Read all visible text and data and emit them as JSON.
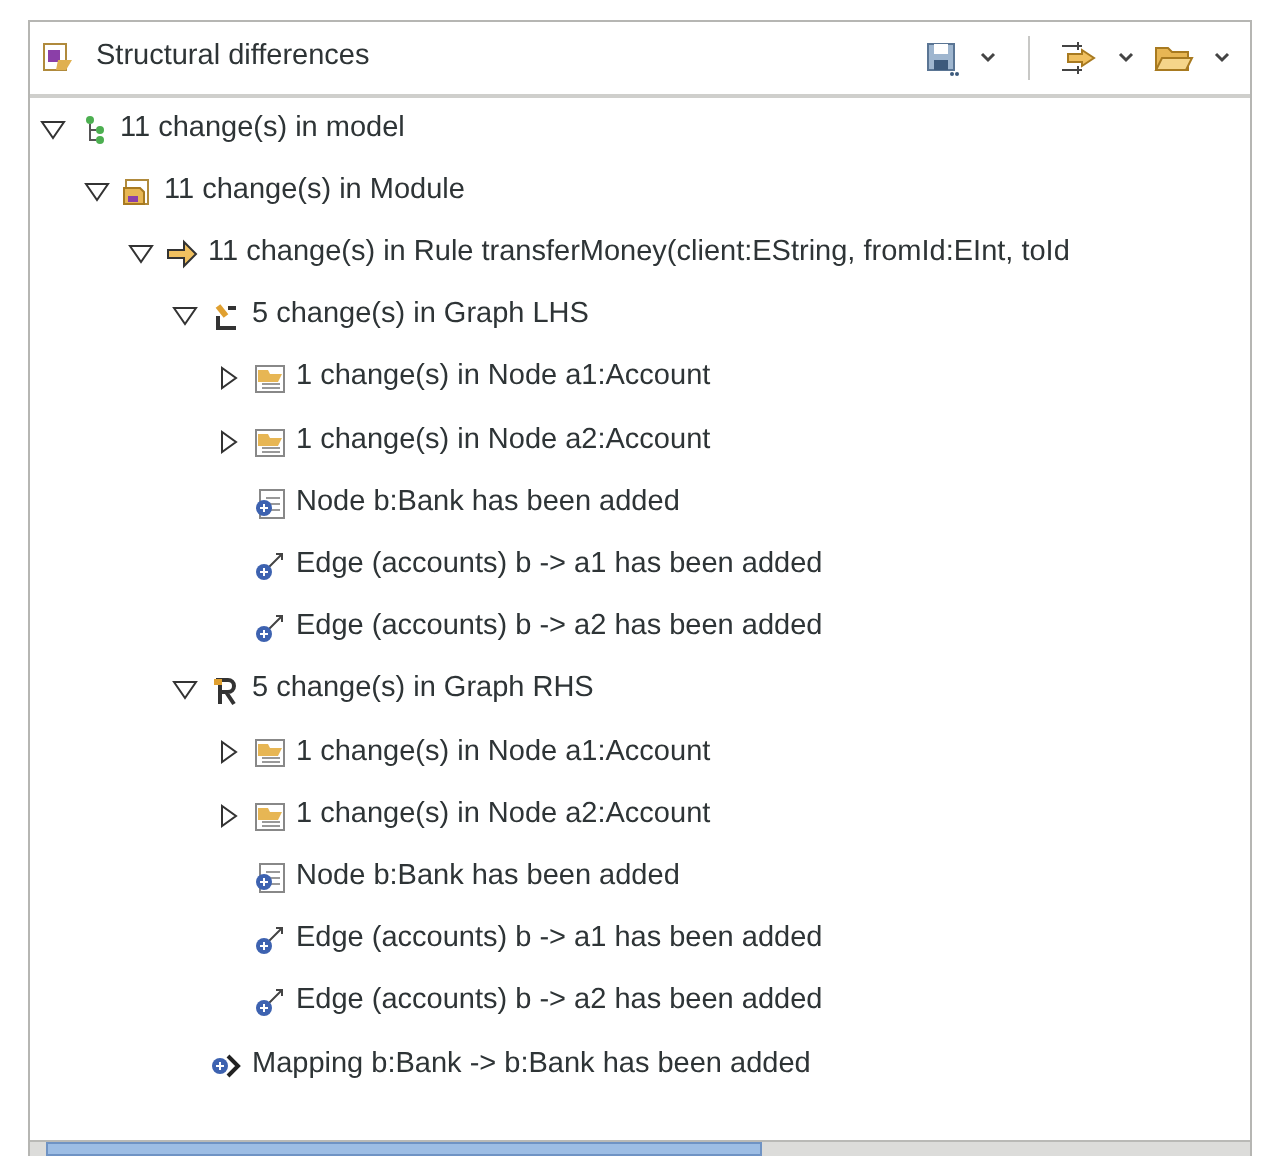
{
  "view": {
    "title": "Structural differences"
  },
  "tree": [
    {
      "kind": "model",
      "label": "11 change(s) in model",
      "expanded": true,
      "children": [
        {
          "kind": "module",
          "label": "11 change(s) in Module",
          "expanded": true,
          "children": [
            {
              "kind": "rule",
              "label": "11 change(s) in Rule transferMoney(client:EString, fromId:EInt, toId",
              "expanded": true,
              "children": [
                {
                  "kind": "lhs",
                  "label": "5 change(s) in Graph LHS",
                  "expanded": true,
                  "children": [
                    {
                      "kind": "node-changed",
                      "label": "1 change(s) in Node a1:Account",
                      "expanded": false
                    },
                    {
                      "kind": "node-changed",
                      "label": "1 change(s) in Node a2:Account",
                      "expanded": false
                    },
                    {
                      "kind": "node-added",
                      "label": "Node b:Bank has been added"
                    },
                    {
                      "kind": "edge-added",
                      "label": "Edge (accounts) b -> a1 has been added"
                    },
                    {
                      "kind": "edge-added",
                      "label": "Edge (accounts) b -> a2 has been added"
                    }
                  ]
                },
                {
                  "kind": "rhs",
                  "label": "5 change(s) in Graph RHS",
                  "expanded": true,
                  "children": [
                    {
                      "kind": "node-changed",
                      "label": "1 change(s) in Node a1:Account",
                      "expanded": false
                    },
                    {
                      "kind": "node-changed",
                      "label": "1 change(s) in Node a2:Account",
                      "expanded": false
                    },
                    {
                      "kind": "node-added",
                      "label": "Node b:Bank has been added"
                    },
                    {
                      "kind": "edge-added",
                      "label": "Edge (accounts) b -> a1 has been added"
                    },
                    {
                      "kind": "edge-added",
                      "label": "Edge (accounts) b -> a2 has been added"
                    }
                  ]
                },
                {
                  "kind": "mapping-added",
                  "label": "Mapping b:Bank -> b:Bank has been added"
                }
              ]
            }
          ]
        }
      ]
    }
  ]
}
